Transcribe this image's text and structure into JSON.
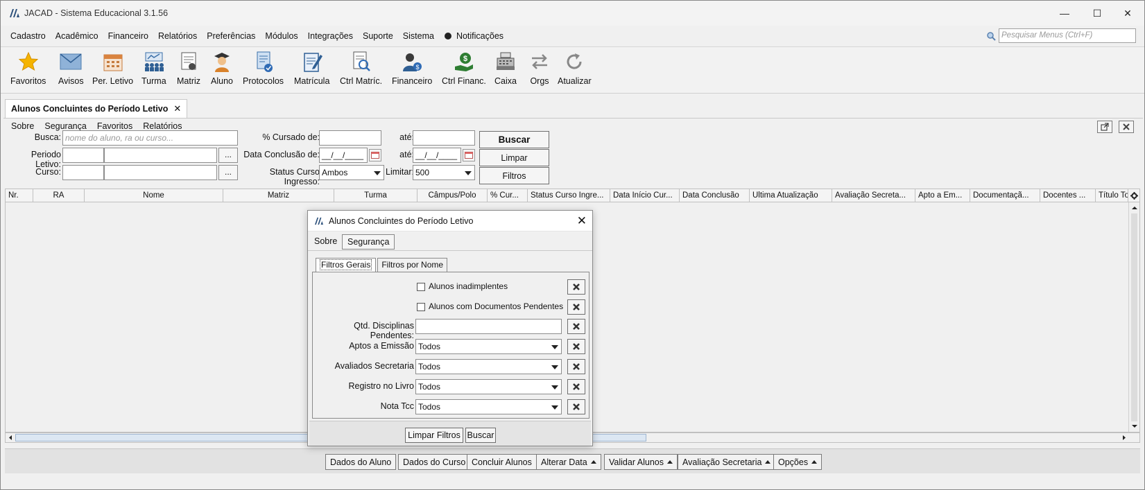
{
  "window": {
    "title": "JACAD - Sistema Educacional 3.1.56",
    "min": "—",
    "max": "☐",
    "close": "✕"
  },
  "menu": {
    "items": [
      "Cadastro",
      "Acadêmico",
      "Financeiro",
      "Relatórios",
      "Preferências",
      "Módulos",
      "Integrações",
      "Suporte",
      "Sistema"
    ],
    "notificacoes": "Notificações",
    "search_placeholder": "Pesquisar Menus (Ctrl+F)"
  },
  "toolbar": {
    "items": [
      "Favoritos",
      "Avisos",
      "Per. Letivo",
      "Turma",
      "Matriz",
      "Aluno",
      "Protocolos",
      "Matrícula",
      "Ctrl Matríc.",
      "Financeiro",
      "Ctrl Financ.",
      "Caixa",
      "Orgs",
      "Atualizar"
    ]
  },
  "tab": {
    "title": "Alunos Concluintes do Período Letivo",
    "close": "✕"
  },
  "submenu": [
    "Sobre",
    "Segurança",
    "Favoritos",
    "Relatórios"
  ],
  "filters": {
    "busca_label": "Busca:",
    "busca_placeholder": "nome do aluno, ra ou curso...",
    "periodo_label": "Periodo Letivo:",
    "curso_label": "Curso:",
    "dots": "...",
    "cursado_label": "% Cursado de:",
    "ate_label": "até:",
    "conclusao_label": "Data Conclusão de:",
    "date_mask": "__/__/____",
    "status_label": "Status Curso Ingresso:",
    "status_value": "Ambos",
    "limitar_label": "Limitar:",
    "limitar_value": "500",
    "buscar": "Buscar",
    "limpar": "Limpar",
    "filtros": "Filtros"
  },
  "grid": {
    "columns": [
      "Nr.",
      "RA",
      "Nome",
      "Matriz",
      "Turma",
      "Câmpus/Polo",
      "% Cur...",
      "Status Curso Ingre...",
      "Data Início Cur...",
      "Data Conclusão",
      "Ultima Atualização",
      "Avaliação Secreta...",
      "Apto a Em...",
      "Documentaçã...",
      "Docentes ...",
      "Título To"
    ]
  },
  "bottom_buttons": [
    {
      "label": "Dados do Aluno",
      "menu": false
    },
    {
      "label": "Dados do Curso",
      "menu": false
    },
    {
      "label": "Concluir Alunos",
      "menu": false
    },
    {
      "label": "Alterar Data",
      "menu": true
    },
    {
      "label": "Validar Alunos",
      "menu": true
    },
    {
      "label": "Avaliação Secretaria",
      "menu": true
    },
    {
      "label": "Opções",
      "menu": true
    }
  ],
  "dialog": {
    "title": "Alunos Concluintes do Período Letivo",
    "close": "✕",
    "menu": [
      "Sobre",
      "Segurança"
    ],
    "tabs": [
      "Filtros Gerais",
      "Filtros por Nome"
    ],
    "chk_inadimplentes": "Alunos inadimplentes",
    "chk_documentos": "Alunos com Documentos Pendentes",
    "qtd_label": "Qtd. Disciplinas Pendentes:",
    "aptos_label": "Aptos a Emissão",
    "avaliados_label": "Avaliados Secretaria",
    "registro_label": "Registro no Livro",
    "nota_label": "Nota Tcc",
    "todos": "Todos",
    "limpar_filtros": "Limpar Filtros",
    "buscar": "Buscar"
  },
  "colors": {
    "accent": "#2b6cb0",
    "selected_tab": "#ffffff"
  }
}
